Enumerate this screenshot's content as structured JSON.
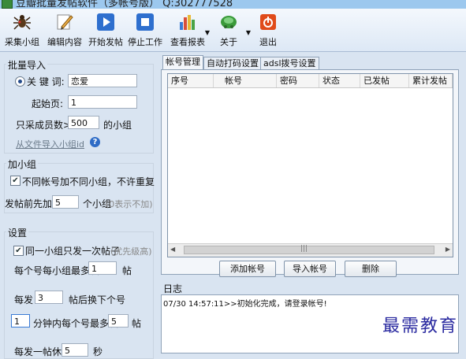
{
  "window": {
    "title": "豆瓣批量发帖软件（多帐号版）   Q:302777528"
  },
  "toolbar": {
    "items": [
      {
        "label": "采集小组",
        "icon": "spider-icon"
      },
      {
        "label": "编辑内容",
        "icon": "pencil-icon"
      },
      {
        "label": "开始发帖",
        "icon": "play-icon"
      },
      {
        "label": "停止工作",
        "icon": "stop-icon"
      },
      {
        "label": "查看报表",
        "icon": "report-icon"
      },
      {
        "label": "关于",
        "icon": "about-icon"
      },
      {
        "label": "退出",
        "icon": "exit-icon"
      }
    ]
  },
  "batch_import": {
    "title": "批量导入",
    "keyword_label": "关 键 词:",
    "keyword_value": "恋爱",
    "start_page_label": "起始页:",
    "start_page_value": "1",
    "member_count_label": "只采成员数>=",
    "member_count_value": "500",
    "member_count_suffix": "的小组",
    "import_file_link": "从文件导入小组id",
    "help_icon_text": "?"
  },
  "join_group": {
    "title": "加小组",
    "no_duplicate_label": "不同帐号加不同小组，不许重复",
    "join_before_label": "发帖前先加",
    "join_before_value": "5",
    "join_before_suffix": "个小组",
    "join_before_hint": "(0表示不加)"
  },
  "settings": {
    "title": "设置",
    "one_post_label": "同一小组只发一次帖子",
    "one_post_hint": "(优先级高)",
    "max_posts_label": "每个号每小组最多发",
    "max_posts_value": "1",
    "max_posts_suffix": "帖",
    "switch_label": "每发",
    "switch_value": "3",
    "switch_suffix": "帖后换下个号",
    "minute_value": "1",
    "minute_label": "分钟内每个号最多发",
    "minute_max_value": "5",
    "minute_suffix": "帖",
    "rest_label": "每发一帖休息",
    "rest_value": "5",
    "rest_suffix": "秒"
  },
  "tabs": [
    {
      "label": "帐号管理",
      "active": true
    },
    {
      "label": "自动打码设置",
      "active": false
    },
    {
      "label": "adsl拨号设置",
      "active": false
    }
  ],
  "account_table": {
    "columns": [
      "序号",
      "帐号",
      "密码",
      "状态",
      "已发帖",
      "累计发帖"
    ],
    "rows": []
  },
  "account_buttons": {
    "add": "添加帐号",
    "import": "导入帐号",
    "delete": "删除"
  },
  "log": {
    "title": "日志",
    "lines": [
      "07/30 14:57:11>>初始化完成，请登录帐号!"
    ]
  },
  "watermark": "最需教育"
}
